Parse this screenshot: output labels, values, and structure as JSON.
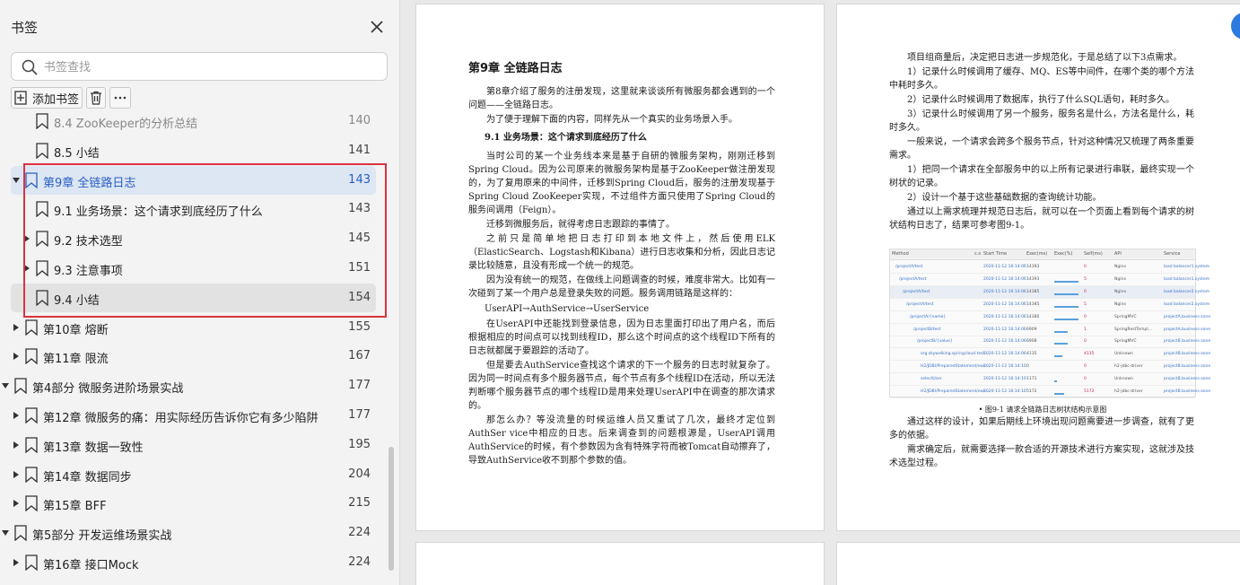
{
  "sidebar": {
    "title": "书签",
    "search_placeholder": "书签查找",
    "add_bookmark_label": "添加书签",
    "items": [
      {
        "title": "8.4 ZooKeeper的分析总结",
        "page": "140",
        "level": 2,
        "arrow": false,
        "state": "clipped"
      },
      {
        "title": "8.5 小结",
        "page": "141",
        "level": 2,
        "arrow": false,
        "state": ""
      },
      {
        "title": "第9章 全链路日志",
        "page": "143",
        "level": 1,
        "arrow": "down",
        "state": "selected"
      },
      {
        "title": "9.1 业务场景：这个请求到底经历了什么",
        "page": "143",
        "level": 2,
        "arrow": false,
        "state": ""
      },
      {
        "title": "9.2 技术选型",
        "page": "145",
        "level": 2,
        "arrow": "right",
        "state": ""
      },
      {
        "title": "9.3 注意事项",
        "page": "151",
        "level": 2,
        "arrow": "right",
        "state": ""
      },
      {
        "title": "9.4 小结",
        "page": "154",
        "level": 2,
        "arrow": false,
        "state": "hover"
      },
      {
        "title": "第10章 熔断",
        "page": "155",
        "level": 1,
        "arrow": "right",
        "state": ""
      },
      {
        "title": "第11章 限流",
        "page": "167",
        "level": 1,
        "arrow": "right",
        "state": ""
      },
      {
        "title": "第4部分 微服务进阶场景实战",
        "page": "177",
        "level": 0,
        "arrow": "down",
        "state": ""
      },
      {
        "title": "第12章 微服务的痛：用实际经历告诉你它有多少陷阱",
        "page": "177",
        "level": 1,
        "arrow": "right",
        "state": ""
      },
      {
        "title": "第13章 数据一致性",
        "page": "195",
        "level": 1,
        "arrow": "right",
        "state": ""
      },
      {
        "title": "第14章 数据同步",
        "page": "204",
        "level": 1,
        "arrow": "right",
        "state": ""
      },
      {
        "title": "第15章 BFF",
        "page": "215",
        "level": 1,
        "arrow": "right",
        "state": ""
      },
      {
        "title": "第5部分 开发运维场景实战",
        "page": "224",
        "level": 0,
        "arrow": "down",
        "state": ""
      },
      {
        "title": "第16章 接口Mock",
        "page": "224",
        "level": 1,
        "arrow": "right",
        "state": ""
      }
    ]
  },
  "page_left": {
    "chapter": "第9章 全链路日志",
    "paragraphs": [
      {
        "kind": "p",
        "text": "第8章介绍了服务的注册发现，这里就来谈谈所有微服务都会遇到的一个问题——全链路日志。"
      },
      {
        "kind": "p",
        "text": "为了便于理解下面的内容，同样先从一个真实的业务场景入手。"
      },
      {
        "kind": "sec",
        "text": "9.1 业务场景：这个请求到底经历了什么"
      },
      {
        "kind": "p",
        "text": "当时公司的某一个业务线本来是基于自研的微服务架构，刚刚迁移到Spring Cloud。因为公司原来的微服务架构是基于ZooKeeper做注册发现的，为了复用原来的中间件，迁移到Spring Cloud后，服务的注册发现基于Spring Cloud ZooKeeper实现，不过组件方面只使用了Spring Cloud的服务间调用（Feign）。"
      },
      {
        "kind": "p",
        "text": "迁移到微服务后，就得考虑日志跟踪的事情了。"
      },
      {
        "kind": "p",
        "text": "之前只是简单地把日志打印到本地文件上，然后使用ELK（ElasticSearch、Logstash和Kibana）进行日志收集和分析，因此日志记录比较随意，且没有形成一个统一的规范。"
      },
      {
        "kind": "p",
        "text": "因为没有统一的规范，在做线上问题调查的时候，难度非常大。比如有一次碰到了某一个用户总是登录失败的问题。服务调用链路是这样的："
      },
      {
        "kind": "code",
        "text": "UserAPI→AuthService→UserService"
      },
      {
        "kind": "p",
        "text": "在UserAPI中还能找到登录信息，因为日志里面打印出了用户名，而后根据相应的时间点可以找到线程ID，那么这个时间点的这个线程ID下所有的日志就都属于要跟踪的活动了。"
      },
      {
        "kind": "p",
        "text": "但是要去AuthService查找这个请求的下一个服务的日志时就复杂了。因为同一时间点有多个服务器节点，每个节点有多个线程ID在活动，所以无法判断哪个服务器节点的哪个线程ID是用来处理UserAPI中在调查的那次请求的。"
      },
      {
        "kind": "p",
        "text": "那怎么办？等没流量的时候运维人员又重试了几次，最终才定位到AuthSer vice中相应的日志。后来调查到的问题根源是，UserAPI调用AuthService的时候，有个参数因为含有特殊字符而被Tomcat自动擦弃了，导致AuthService收不到那个参数的值。"
      }
    ]
  },
  "page_right": {
    "paragraphs_a": [
      {
        "kind": "p",
        "text": "项目组商量后，决定把日志进一步规范化，于是总结了以下3点需求。"
      },
      {
        "kind": "p",
        "text": "1）记录什么时候调用了缓存、MQ、ES等中间件，在哪个类的哪个方法中耗时多久。"
      },
      {
        "kind": "p",
        "text": "2）记录什么时候调用了数据库，执行了什么SQL语句，耗时多久。"
      },
      {
        "kind": "p",
        "text": "3）记录什么时候调用了另一个服务，服务名是什么，方法名是什么，耗时多久。"
      },
      {
        "kind": "p",
        "text": "一般来说，一个请求会跨多个服务节点，针对这种情况又梳理了两条重要需求。"
      },
      {
        "kind": "p",
        "text": "1）把同一个请求在全部服务中的以上所有记录进行串联，最终实现一个树状的记录。"
      },
      {
        "kind": "p",
        "text": "2）设计一个基于这些基础数据的查询统计功能。"
      },
      {
        "kind": "p",
        "text": "通过以上需求梳理并规范日志后，就可以在一个页面上看到每个请求的树状结构日志了，结果可参考图9-1。"
      }
    ],
    "figure": {
      "headers": [
        "Method",
        "c.s",
        "Start Time",
        "Exec(ms)",
        "Exec(%)",
        "Self(ms)",
        "API",
        "Service"
      ],
      "rows": [
        {
          "method": "/projectA/test",
          "time": "2020-11-12 16:14:06",
          "exec": "14393",
          "self": "0",
          "api": "Nginx",
          "service": "load balancer1.system",
          "bar": 0.0
        },
        {
          "method": "/projectA/test",
          "time": "2020-11-12 16:14:06",
          "exec": "14393",
          "self": "5",
          "api": "Nginx",
          "service": "load balancer1.system",
          "bar": 0.9
        },
        {
          "method": "/projectA/test",
          "time": "2020-11-12 16:14:06",
          "exec": "14385",
          "self": "0",
          "api": "Nginx",
          "service": "load balancer2.system",
          "bar": 0.9
        },
        {
          "method": "/projectA/test",
          "time": "2020-11-12 16:14:06",
          "exec": "14385",
          "self": "5",
          "api": "Nginx",
          "service": "load balancer2.system",
          "bar": 0.9
        },
        {
          "method": "/projectA/{name}",
          "time": "2020-11-12 16:14:06",
          "exec": "14380",
          "self": "0",
          "api": "SpringMVC",
          "service": "projectA.business-zone",
          "bar": 0.9
        },
        {
          "method": "/projectB/test",
          "time": "2020-11-12 16:14:06",
          "exec": "6909",
          "self": "1",
          "api": "SpringRestTempl...",
          "service": "projectA.business-zone",
          "bar": 0.5
        },
        {
          "method": "/projectB/{value}",
          "time": "2020-11-12 16:14:06",
          "exec": "6908",
          "self": "0",
          "api": "SpringMVC",
          "service": "projectB.business-zone",
          "bar": 0.5
        },
        {
          "method": "org.skywalking.springcloud.test...",
          "time": "2020-11-12 16:14:06",
          "exec": "4135",
          "self": "4135",
          "api": "Unknown",
          "service": "projectB.business-zone",
          "bar": 0.3
        },
        {
          "method": "H2/JDBI/PreparedStatement/exe...",
          "time": "2020-11-12 16:14:10",
          "exec": "0",
          "self": "0",
          "api": "h2-jdbc-driver",
          "service": "projectB.business-zone",
          "bar": 0.0
        },
        {
          "method": "selectUser",
          "time": "2020-11-12 16:14:10",
          "exec": "1171",
          "self": "0",
          "api": "Unknown",
          "service": "projectB.business-zone",
          "bar": 0.1
        },
        {
          "method": "H2/JDBI/PreparedStatement/exe...",
          "time": "2020-11-12 16:14:10",
          "exec": "5172",
          "self": "5172",
          "api": "h2-jdbc-driver",
          "service": "projectB.business-zone",
          "bar": 0.35
        }
      ]
    },
    "caption": "• 图9-1 请求全链路日志树状结构示意图",
    "paragraphs_b": [
      {
        "kind": "p",
        "text": "通过这样的设计，如果后期线上环境出现问题需要进一步调查，就有了更多的依据。"
      },
      {
        "kind": "p",
        "text": "需求确定后，就需要选择一款合适的开源技术进行方案实现，这就涉及技术选型过程。"
      }
    ]
  },
  "colors": {
    "selected_text": "#2860c4",
    "selection_box": "#d9333f",
    "selected_bg": "#dde6f3"
  }
}
